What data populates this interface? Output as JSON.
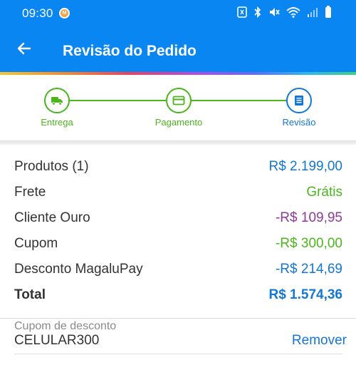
{
  "status_bar": {
    "time": "09:30",
    "icons": [
      "nfc-icon",
      "bluetooth-icon",
      "mute-icon",
      "wifi-icon",
      "signal-icon",
      "battery-icon"
    ]
  },
  "app_bar": {
    "title": "Revisão do Pedido",
    "back_icon": "arrow-left-icon"
  },
  "stepper": {
    "steps": [
      {
        "label": "Entrega",
        "icon": "truck-icon",
        "state": "done"
      },
      {
        "label": "Pagamento",
        "icon": "card-icon",
        "state": "done"
      },
      {
        "label": "Revisão",
        "icon": "document-icon",
        "state": "current"
      }
    ],
    "colors": {
      "done": "#4bb51d",
      "current": "#1477d4"
    }
  },
  "summary": {
    "rows": [
      {
        "label": "Produtos (1)",
        "value": "R$ 2.199,00",
        "color": "#1477d4"
      },
      {
        "label": "Frete",
        "value": "Grátis",
        "color": "#4bb51d"
      },
      {
        "label": "Cliente Ouro",
        "value": "-R$ 109,95",
        "color": "#8e3a9a"
      },
      {
        "label": "Cupom",
        "value": "-R$ 300,00",
        "color": "#4bb51d"
      },
      {
        "label": "Desconto MagaluPay",
        "value": "-R$ 214,69",
        "color": "#1477d4"
      },
      {
        "label": "Total",
        "value": "R$ 1.574,36",
        "color": "#1477d4"
      }
    ]
  },
  "coupon": {
    "label": "Cupom de desconto",
    "value": "CELULAR300",
    "remove_label": "Remover",
    "remove_color": "#1477d4"
  },
  "colors": {
    "primary": "#0a86f3",
    "text": "#333333"
  }
}
